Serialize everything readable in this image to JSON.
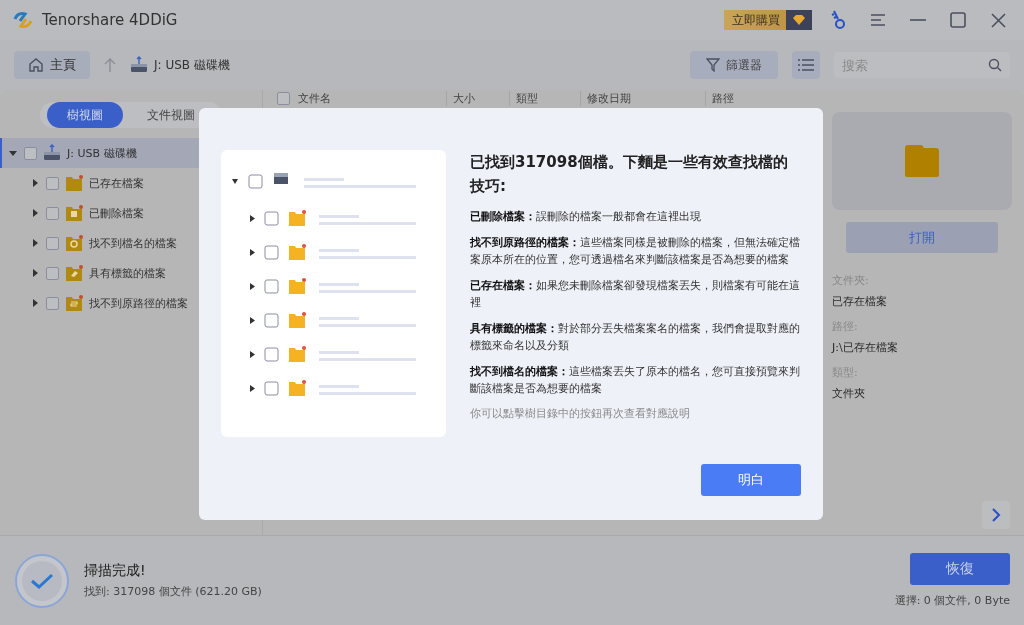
{
  "app": {
    "title": "Tenorshare 4DDiG",
    "buy_label": "立即購買"
  },
  "toolbar": {
    "home": "主頁",
    "path": "J: USB 磁碟機",
    "filter": "篩選器",
    "search": {
      "placeholder": "搜索"
    }
  },
  "view_tabs": [
    {
      "label": "樹視圖",
      "selected": true
    },
    {
      "label": "文件視圖",
      "selected": false
    }
  ],
  "tree": [
    {
      "label": "J: USB 磁碟機",
      "kind": "drive",
      "expanded": true,
      "checked": false,
      "selected": true,
      "children": [
        {
          "label": "已存在檔案",
          "kind": "existing",
          "expanded": false,
          "checked": false,
          "selected": false
        },
        {
          "label": "已刪除檔案",
          "kind": "deleted",
          "expanded": false,
          "checked": false,
          "selected": false
        },
        {
          "label": "找不到檔名的檔案",
          "kind": "noname",
          "expanded": false,
          "checked": false,
          "selected": false
        },
        {
          "label": "具有標籤的檔案",
          "kind": "tagged",
          "expanded": false,
          "checked": false,
          "selected": false
        },
        {
          "label": "找不到原路徑的檔案",
          "kind": "nopath",
          "expanded": false,
          "checked": false,
          "selected": false
        }
      ]
    }
  ],
  "table": {
    "all_checked": false,
    "columns": [
      "文件名",
      "大小",
      "類型",
      "修改日期",
      "路徑"
    ]
  },
  "details": {
    "open_button": "打開",
    "fields": [
      {
        "label": "文件夾:",
        "value": "已存在檔案"
      },
      {
        "label": "路徑:",
        "value": "J:\\已存在檔案"
      },
      {
        "label": "類型:",
        "value": "文件夾"
      }
    ]
  },
  "status": {
    "title": "掃描完成!",
    "summary": "找到: 317098 個文件 (621.20 GB)",
    "recover_button": "恢復",
    "selection": "選擇: 0 個文件, 0 Byte"
  },
  "dialog": {
    "title": "已找到317098個檔。下麵是一些有效查找檔的技巧:",
    "tips": [
      "**已刪除檔案：**誤刪除的檔案一般都會在這裡出現",
      "**找不到原路徑的檔案：**這些檔案同樣是被刪除的檔案，但無法確定檔案原本所在的位置，您可透過檔名來判斷該檔案是否為想要的檔案",
      "**已存在檔案：**如果您未刪除檔案卻發現檔案丟失，則檔案有可能在這裡",
      "**具有標籤的檔案：**對於部分丟失檔案案名的檔案，我們會提取對應的標籤來命名以及分類",
      "**找不到檔名的檔案：**這些檔案丟失了原本的檔名，您可直接預覽來判斷該檔案是否為想要的檔案"
    ],
    "hint": "你可以點擊樹目錄中的按鈕再次查看對應說明",
    "button": "明白"
  }
}
